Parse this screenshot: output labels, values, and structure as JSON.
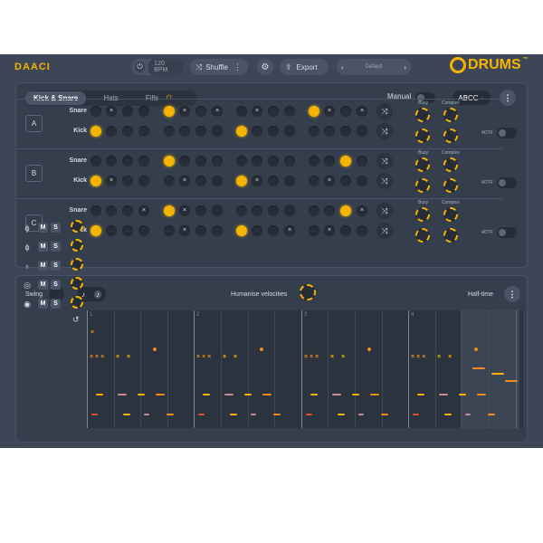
{
  "header": {
    "logo": "DAACI",
    "power_icon": "power-icon",
    "bpm": "120 BPM",
    "shuffle_label": "Shuffle",
    "export_label": "Export",
    "preset": "Default",
    "brand": "DRUMS",
    "trademark": "™"
  },
  "pattern_panel": {
    "tabs": [
      {
        "label": "Kick & Snare",
        "active": true
      },
      {
        "label": "Hats",
        "active": false
      },
      {
        "label": "Fills",
        "active": false
      }
    ],
    "manual_label": "Manual",
    "key_select": "ABCC",
    "sections": [
      {
        "label": "A",
        "rows": [
          {
            "name": "Snare",
            "steps": [
              0,
              2,
              0,
              0,
              1,
              2,
              0,
              2,
              0,
              2,
              0,
              0,
              1,
              2,
              0,
              2
            ]
          },
          {
            "name": "Kick",
            "steps": [
              1,
              0,
              0,
              0,
              0,
              0,
              0,
              0,
              1,
              0,
              0,
              0,
              0,
              0,
              0,
              0
            ]
          }
        ],
        "busy_label": "Busy",
        "complex_label": "Complex",
        "fourtf_label": "4OTF"
      },
      {
        "label": "B",
        "rows": [
          {
            "name": "Snare",
            "steps": [
              0,
              0,
              0,
              0,
              1,
              0,
              0,
              0,
              0,
              0,
              0,
              0,
              0,
              0,
              1,
              0
            ]
          },
          {
            "name": "Kick",
            "steps": [
              1,
              2,
              0,
              0,
              0,
              2,
              0,
              0,
              1,
              2,
              0,
              0,
              0,
              2,
              0,
              0
            ]
          }
        ],
        "busy_label": "Busy",
        "complex_label": "Complex",
        "fourtf_label": "4OTF"
      },
      {
        "label": "C",
        "rows": [
          {
            "name": "Snare",
            "steps": [
              0,
              0,
              0,
              2,
              1,
              2,
              0,
              0,
              0,
              0,
              0,
              0,
              0,
              0,
              1,
              2
            ]
          },
          {
            "name": "Kick",
            "steps": [
              1,
              0,
              0,
              0,
              0,
              2,
              0,
              0,
              1,
              0,
              0,
              2,
              0,
              2,
              0,
              0
            ]
          }
        ],
        "busy_label": "Busy",
        "complex_label": "Complex",
        "fourtf_label": "4OTF"
      }
    ]
  },
  "lower_panel": {
    "swing_label": "Swing",
    "humanise_label": "Humanise velocities",
    "halftime_label": "Half-time",
    "bar_numbers": [
      "1",
      "2",
      "3",
      "4"
    ],
    "lanes": [
      {
        "icon": "hihat-closed-icon",
        "mute": "M",
        "solo": "S"
      },
      {
        "icon": "hihat-open-icon",
        "mute": "M",
        "solo": "S"
      },
      {
        "icon": "cymbal-icon",
        "mute": "M",
        "solo": "S"
      },
      {
        "icon": "snare-icon",
        "mute": "M",
        "solo": "S"
      },
      {
        "icon": "kick-icon",
        "mute": "M",
        "solo": "S"
      }
    ]
  },
  "colors": {
    "accent": "#f5b400",
    "orange": "#f08a1c",
    "red": "#e0502a",
    "pink": "#c98a98",
    "bg": "#3d4656",
    "panel": "#353e4d"
  }
}
